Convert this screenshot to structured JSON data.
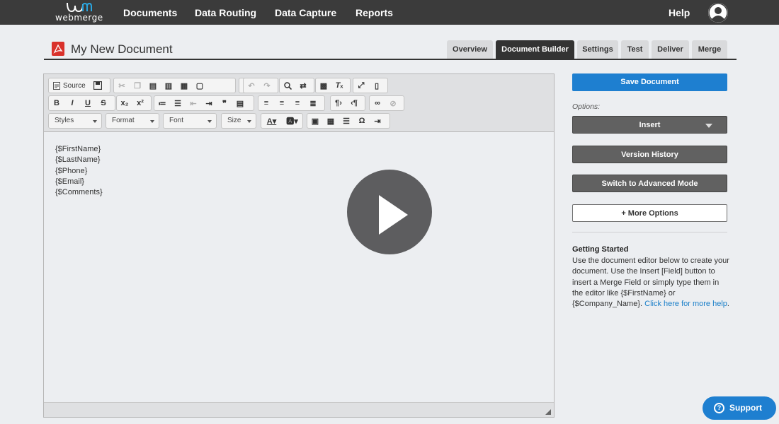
{
  "nav": {
    "logo_text": "webmerge",
    "items": [
      "Documents",
      "Data Routing",
      "Data Capture",
      "Reports"
    ],
    "help": "Help"
  },
  "document": {
    "title": "My New Document",
    "tabs": [
      "Overview",
      "Document Builder",
      "Settings",
      "Test",
      "Deliver",
      "Merge"
    ],
    "active_tab": "Document Builder"
  },
  "editor": {
    "source_label": "Source",
    "combos": [
      "Styles",
      "Format",
      "Font",
      "Size"
    ],
    "content_lines": [
      "{$FirstName}",
      "{$LastName}",
      "{$Phone}",
      "{$Email}",
      "{$Comments}"
    ]
  },
  "sidebar": {
    "save_button": "Save Document",
    "options_label": "Options:",
    "insert_button": "Insert",
    "version_history_button": "Version History",
    "advanced_mode_button": "Switch to Advanced Mode",
    "more_options_button": "+ More Options",
    "getting_started_title": "Getting Started",
    "getting_started_text": "Use the document editor below to create your document. Use the Insert [Field] button to insert a Merge Field or simply type them in the editor like {$FirstName} or {$Company_Name}.",
    "help_link": "Click here for more help"
  },
  "support_label": "Support",
  "colors": {
    "nav_bg": "#3b3b3b",
    "accent_blue": "#1e7fd0",
    "pdf_red": "#d9312b",
    "dark_button": "#616161"
  }
}
